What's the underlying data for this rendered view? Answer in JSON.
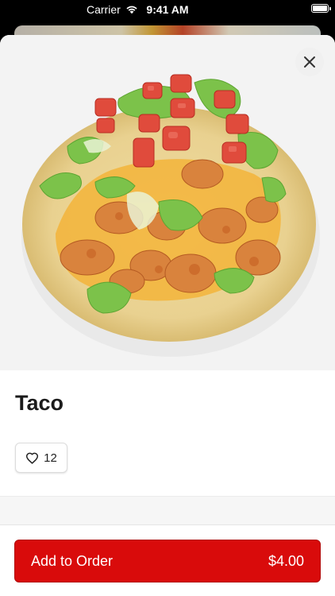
{
  "status_bar": {
    "carrier": "Carrier",
    "time": "9:41 AM"
  },
  "item": {
    "title": "Taco",
    "likes": "12",
    "image_subject": "taco-photo"
  },
  "footer": {
    "add_label": "Add to Order",
    "price": "$4.00"
  },
  "colors": {
    "accent": "#d90b0b",
    "background": "#ffffff"
  },
  "icons": {
    "close": "close-icon",
    "heart": "heart-icon",
    "wifi": "wifi-icon",
    "battery": "battery-icon"
  }
}
